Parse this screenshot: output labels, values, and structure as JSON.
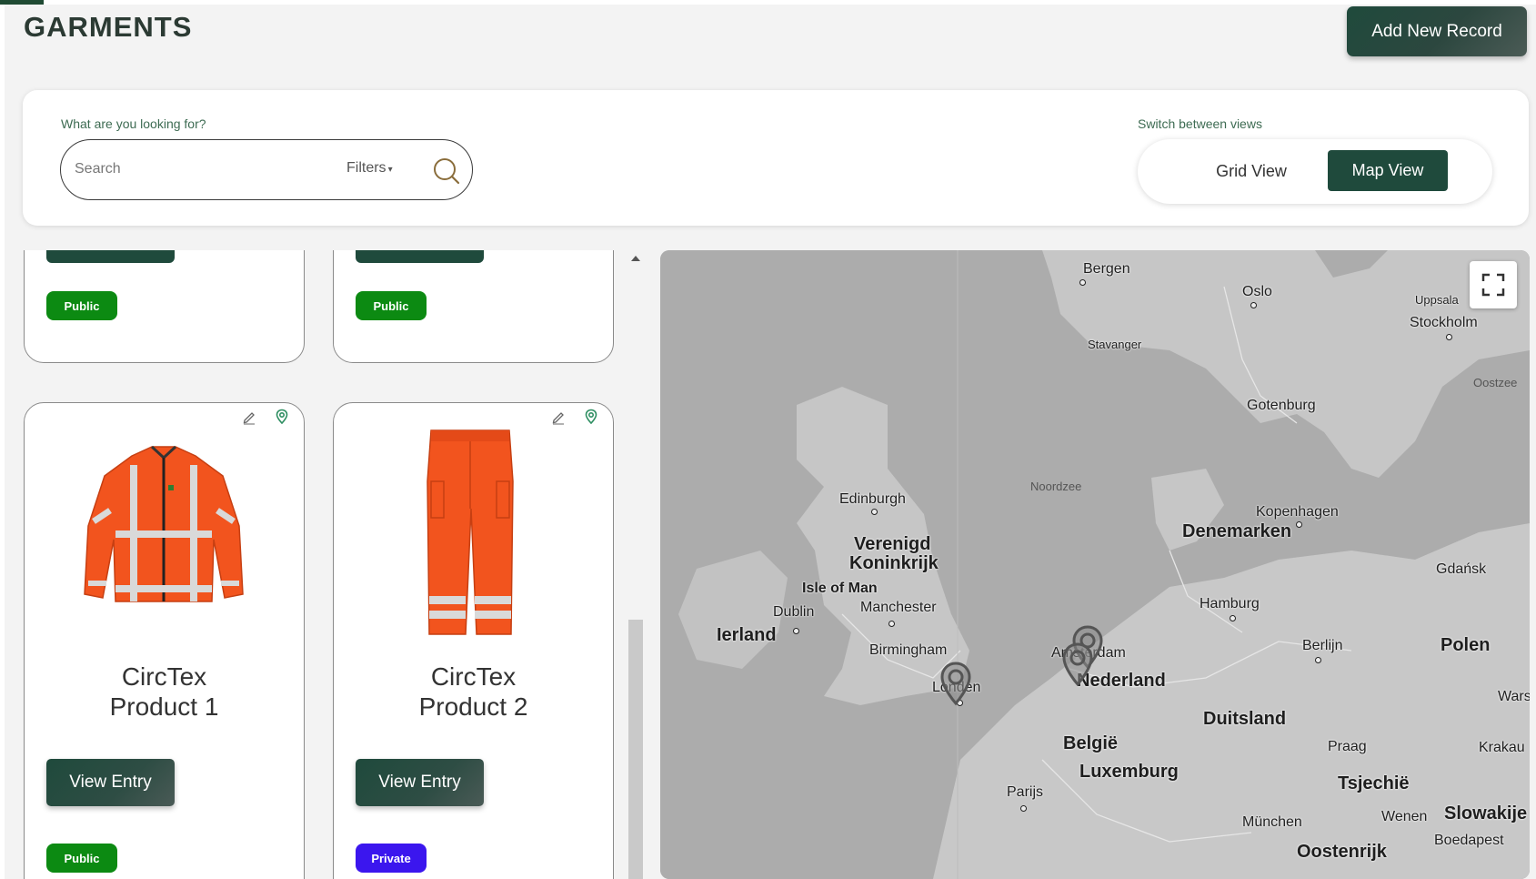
{
  "page": {
    "title": "GARMENTS",
    "add_button_label": "Add New Record"
  },
  "search": {
    "label": "What are you looking for?",
    "placeholder": "Search",
    "filters_label": "Filters"
  },
  "views": {
    "label": "Switch between views",
    "grid_label": "Grid View",
    "map_label": "Map View",
    "active": "Map View"
  },
  "cards_top": [
    {
      "visibility": "Public"
    },
    {
      "visibility": "Public"
    }
  ],
  "cards": [
    {
      "name": "CircTex\nProduct 1",
      "image": "orange-jacket",
      "button_label": "View Entry",
      "visibility": "Public"
    },
    {
      "name": "CircTex\nProduct 2",
      "image": "orange-trousers",
      "button_label": "View Entry",
      "visibility": "Private"
    }
  ],
  "map": {
    "labels": {
      "bergen": "Bergen",
      "oslo": "Oslo",
      "uppsala": "Uppsala",
      "stockholm": "Stockholm",
      "stavanger": "Stavanger",
      "oostzee": "Oostzee",
      "gotenburg": "Gotenburg",
      "noordzee": "Noordzee",
      "edinburgh": "Edinburgh",
      "kopenhagen": "Kopenhagen",
      "denemarken": "Denemarken",
      "verenigd": "Verenigd",
      "koninkrijk": "Koninkrijk",
      "gdansk": "Gdańsk",
      "isle_of_man": "Isle of Man",
      "dublin": "Dublin",
      "manchester": "Manchester",
      "hamburg": "Hamburg",
      "ierland": "Ierland",
      "polen": "Polen",
      "birmingham": "Birmingham",
      "amsterdam": "Amsterdam",
      "berlijn": "Berlijn",
      "nederland": "Nederland",
      "londen": "Londen",
      "wars": "Wars",
      "duitsland": "Duitsland",
      "belgie": "België",
      "praag": "Praag",
      "krakau": "Krakau",
      "luxemburg": "Luxemburg",
      "tsjechie": "Tsjechië",
      "parijs": "Parijs",
      "slowakije": "Slowakije",
      "munchen": "München",
      "wenen": "Wenen",
      "boedapest": "Boedapest",
      "oostenrijk": "Oostenrijk"
    }
  },
  "colors": {
    "brand_dark_green": "#1f4a3c",
    "public_badge": "#0c8a12",
    "private_badge": "#3b16ee",
    "garment_orange": "#f2541e"
  }
}
